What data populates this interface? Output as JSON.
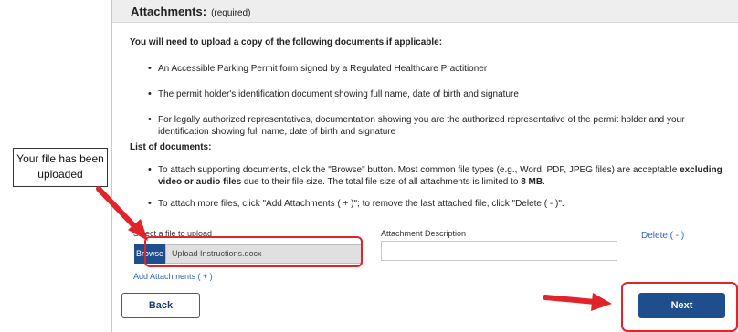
{
  "header": {
    "title": "Attachments:",
    "required": "(required)"
  },
  "intro": "You will need to upload a copy of the following documents if applicable:",
  "requirements": [
    "An Accessible Parking Permit form signed by a Regulated Healthcare Practitioner",
    "The permit holder's identification document showing full name, date of birth and signature",
    "For legally authorized representatives, documentation showing you are the authorized representative of the permit holder and your identification showing full name, date of birth and signature"
  ],
  "list_title": "List of documents:",
  "instructions": {
    "attach_pre": "To attach supporting documents, click the \"Browse\" button. Most common file types (e.g., Word, PDF, JPEG files) are acceptable ",
    "attach_bold": "excluding video or audio files",
    "attach_mid": " due to their file size. The total file size of all attachments is limited to ",
    "attach_limit": "8 MB",
    "attach_end": ".",
    "more": "To attach more files, click \"Add Attachments ( + )\"; to remove the last attached file, click \"Delete ( - )\"."
  },
  "upload": {
    "file_label": "Select a file to upload",
    "browse_label": "Browse",
    "file_name": "Upload Instructions.docx",
    "description_label": "Attachment Description",
    "description_value": "",
    "delete_label": "Delete ( - )",
    "add_label": "Add Attachments ( + )"
  },
  "nav": {
    "back_label": "Back",
    "next_label": "Next"
  },
  "annotation": {
    "callout_text": "Your file has been uploaded"
  },
  "colors": {
    "primary": "#1f4e8c",
    "link": "#2f65b8",
    "highlight": "#e0242a"
  }
}
